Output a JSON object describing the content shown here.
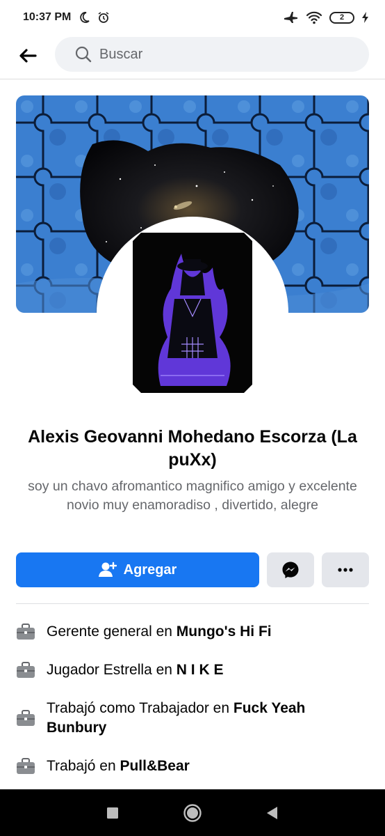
{
  "status": {
    "time": "10:37 PM",
    "battery": "2"
  },
  "header": {
    "search_placeholder": "Buscar"
  },
  "profile": {
    "name": "Alexis Geovanni Mohedano Escorza (La puXx)",
    "bio": "soy un chavo afromantico magnifico amigo y excelente novio muy enamoradiso , divertido, alegre"
  },
  "actions": {
    "add_label": "Agregar"
  },
  "work": [
    {
      "prefix": "Gerente general en ",
      "place": "Mungo's Hi Fi"
    },
    {
      "prefix": "Jugador Estrella en ",
      "place": "N I K E"
    },
    {
      "prefix": "Trabajó como Trabajador en ",
      "place": "Fuck Yeah Bunbury"
    },
    {
      "prefix": "Trabajó en ",
      "place": "Pull&Bear"
    }
  ],
  "colors": {
    "accent": "#1877f2",
    "secondary_button": "#e4e6eb",
    "muted_text": "#65676b"
  },
  "icons": [
    "moon-icon",
    "alarm-icon",
    "airplane-icon",
    "wifi-icon",
    "battery-icon",
    "charging-icon",
    "back-arrow-icon",
    "search-icon",
    "add-friend-icon",
    "messenger-icon",
    "more-icon",
    "briefcase-icon",
    "nav-square-icon",
    "nav-home-icon",
    "nav-back-icon"
  ]
}
